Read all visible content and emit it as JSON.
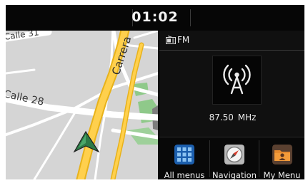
{
  "status": {
    "time": "01:02"
  },
  "map": {
    "street_labels": [
      "Calle 31",
      "Carrera",
      "Calle 28"
    ]
  },
  "radio": {
    "source": "FM",
    "frequency": "87.50",
    "unit": "MHz"
  },
  "bottom_menu": [
    {
      "label": "All menus",
      "icon": "grid-icon"
    },
    {
      "label": "Navigation",
      "icon": "compass-icon"
    },
    {
      "label": "My Menu",
      "icon": "folder-person-icon"
    }
  ]
}
